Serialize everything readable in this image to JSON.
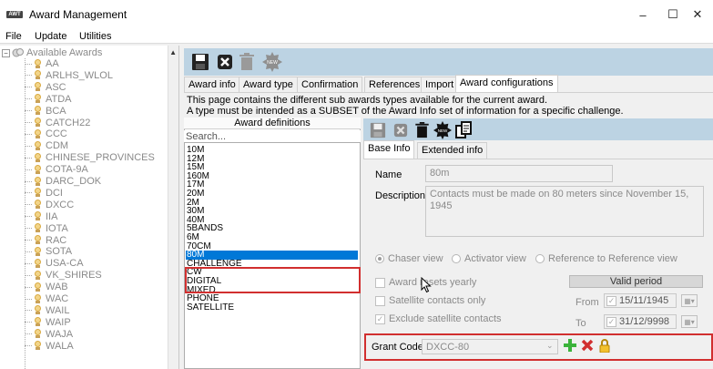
{
  "window": {
    "title": "Award Management",
    "icon_text": "AWT",
    "minimize": "–",
    "maximize": "☐",
    "close": "✕"
  },
  "menu": [
    "File",
    "Update",
    "Utilities"
  ],
  "tree": {
    "root_label": "Available Awards",
    "items": [
      "AA",
      "ARLHS_WLOL",
      "ASC",
      "ATDA",
      "BCA",
      "CATCH22",
      "CCC",
      "CDM",
      "CHINESE_PROVINCES",
      "COTA-9A",
      "DARC_DOK",
      "DCI",
      "DXCC",
      "IIA",
      "IOTA",
      "RAC",
      "SOTA",
      "USA-CA",
      "VK_SHIRES",
      "WAB",
      "WAC",
      "WAIL",
      "WAIP",
      "WAJA",
      "WALA"
    ]
  },
  "toolbar_icons": [
    "save-icon",
    "close-icon",
    "delete-icon",
    "new-icon"
  ],
  "tabs": [
    "Award info",
    "Award type",
    "Confirmation",
    "References",
    "Import",
    "Award configurations"
  ],
  "active_tab": "Award configurations",
  "info_text": [
    "This page contains the different sub awards types available for the current award.",
    "A type must be intended as a SUBSET of the Award Info set of information for a specific challenge."
  ],
  "definitions": {
    "header": "Award definitions",
    "search_placeholder": "Search...",
    "items": [
      "10M",
      "12M",
      "15M",
      "160M",
      "17M",
      "20M",
      "2M",
      "30M",
      "40M",
      "5BANDS",
      "6M",
      "70CM",
      "80M",
      "CHALLENGE",
      "CW",
      "DIGITAL",
      "MIXED",
      "PHONE",
      "SATELLITE"
    ],
    "selected": "80M"
  },
  "sub_tabs": [
    "Base Info",
    "Extended info"
  ],
  "base_info": {
    "name_label": "Name",
    "name_value": "80m",
    "description_label": "Description",
    "description_value": "Contacts must be made on 80 meters since November 15, 1945",
    "radio_options": [
      "Chaser view",
      "Activator view",
      "Reference to Reference view"
    ],
    "award_resets_label": "Award resets yearly",
    "satellite_only_label": "Satellite contacts only",
    "exclude_satellite_label": "Exclude satellite contacts",
    "exclude_satellite_checked": true,
    "valid_period_label": "Valid period",
    "from_label": "From",
    "from_date": "15/11/1945",
    "to_label": "To",
    "to_date": "31/12/9998",
    "grant_code_label": "Grant Code",
    "grant_code_value": "DXCC-80"
  },
  "colors": {
    "toolbar": "#bcd3e3",
    "selection": "#0078d7",
    "highlight": "#d12f2f"
  }
}
